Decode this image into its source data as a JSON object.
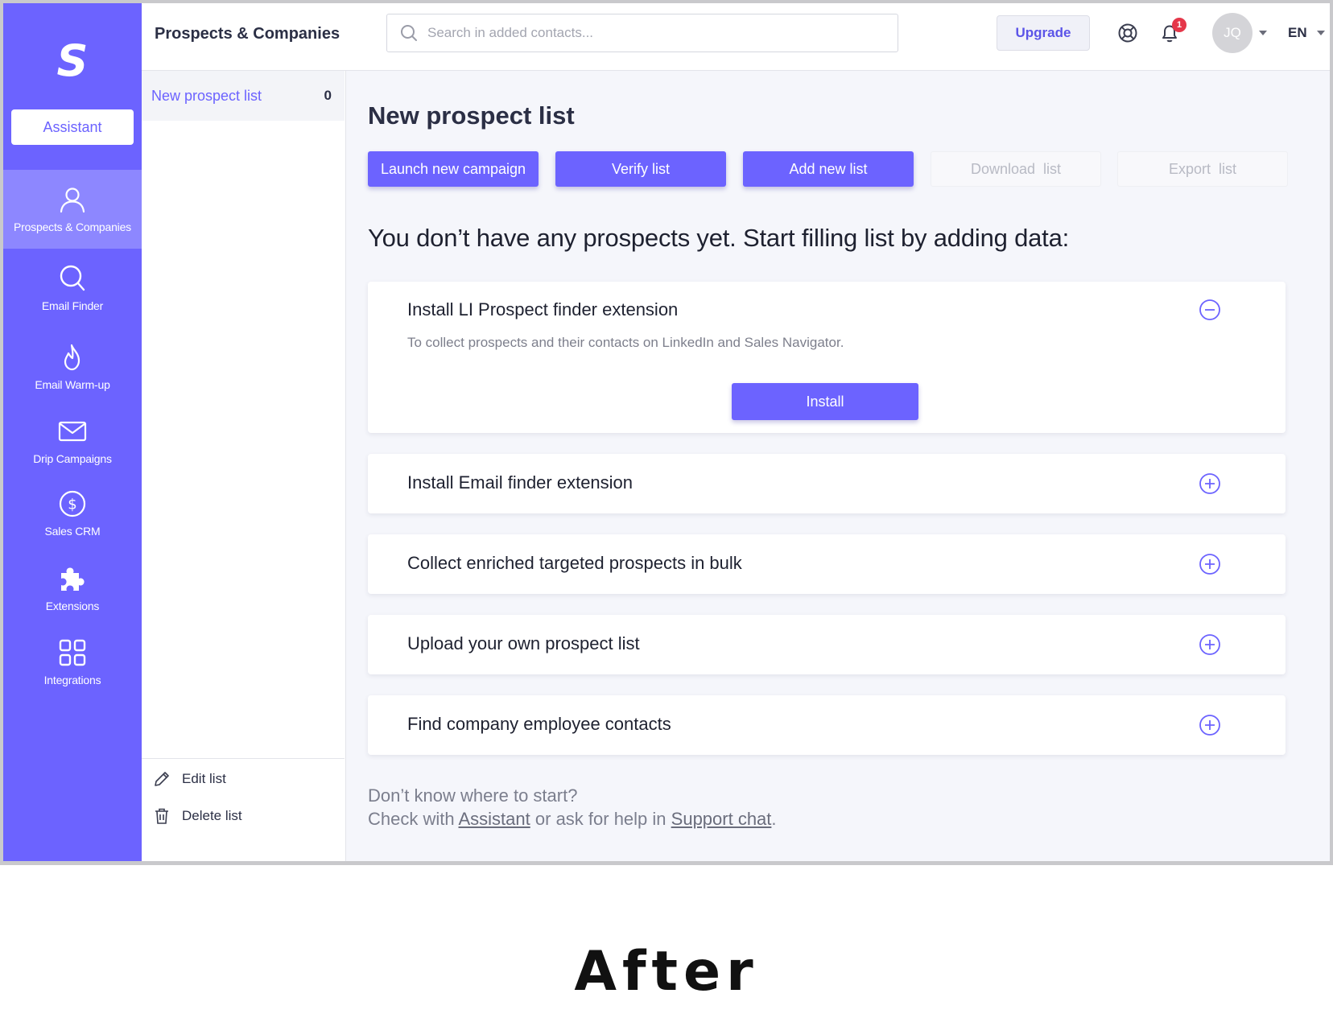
{
  "sidebar": {
    "logo": "S",
    "assistant_label": "Assistant",
    "items": [
      {
        "label": "Prospects & Companies",
        "icon": "person-icon",
        "active": true
      },
      {
        "label": "Email Finder",
        "icon": "search-icon"
      },
      {
        "label": "Email Warm-up",
        "icon": "flame-icon"
      },
      {
        "label": "Drip Campaigns",
        "icon": "envelope-icon"
      },
      {
        "label": "Sales CRM",
        "icon": "dollar-icon"
      },
      {
        "label": "Extensions",
        "icon": "puzzle-icon"
      },
      {
        "label": "Integrations",
        "icon": "grid-icon"
      }
    ]
  },
  "header": {
    "title": "Prospects & Companies",
    "search_placeholder": "Search in added contacts...",
    "upgrade_label": "Upgrade",
    "notification_count": "1",
    "avatar_initials": "JQ",
    "language": "EN"
  },
  "lists": {
    "items": [
      {
        "name": "New prospect list",
        "count": "0"
      }
    ],
    "edit_label": "Edit list",
    "delete_label": "Delete list"
  },
  "main": {
    "title": "New prospect list",
    "buttons": {
      "launch_campaign": "Launch new campaign",
      "verify": "Verify list",
      "add_new": "Add new list",
      "download": "Download  list",
      "export": "Export  list"
    },
    "empty_message": "You don’t have any prospects yet. Start filling list by adding data:",
    "cards": [
      {
        "title": "Install LI Prospect finder extension",
        "description": "To collect prospects and their contacts on LinkedIn and Sales Navigator.",
        "action": "Install",
        "expanded": true
      },
      {
        "title": "Install Email finder extension",
        "expanded": false
      },
      {
        "title": "Collect enriched targeted prospects in bulk",
        "expanded": false
      },
      {
        "title": "Upload your own prospect list",
        "expanded": false
      },
      {
        "title": "Find company employee contacts",
        "expanded": false
      }
    ],
    "help": {
      "line1": "Don’t know where to start?",
      "prefix": "Check with",
      "assistant_link": "Assistant",
      "middle": "or ask for help in",
      "support_link": "Support chat",
      "suffix": "."
    }
  },
  "caption": "After",
  "colors": {
    "accent": "#6c63ff",
    "sidebar_active": "#8d87ff",
    "badge": "#e5374a",
    "text_dark": "#2b2f45"
  }
}
